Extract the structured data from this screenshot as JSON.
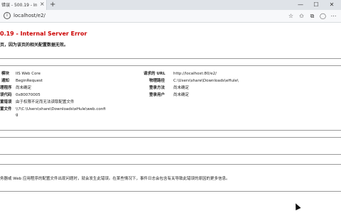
{
  "browser": {
    "tab_title": "错误 - 500.19 - Inte",
    "tab_close": "×",
    "new_tab": "+",
    "url": "localhost/e2/",
    "window_controls": [
      "—",
      "☐",
      "✕"
    ],
    "nav_icons": [
      "star-outline-icon",
      "favorites-icon",
      "collections-icon",
      "profile-icon",
      "more-icon"
    ]
  },
  "error": {
    "title": "0.19 - Internal Server Error",
    "subtitle": "页，因为该页的相关配置数据无效。"
  },
  "details_left": [
    {
      "label": "模块",
      "value": "IIS Web Core"
    },
    {
      "label": "通知",
      "value": "BeginRequest"
    },
    {
      "label": "理程序",
      "value": "尚未确定"
    },
    {
      "label": "误代码",
      "value": "0x80070005"
    },
    {
      "label": "置错误",
      "value": "由于权限不足而无法读取配置文件"
    },
    {
      "label": "置文件",
      "value": "\\\\?\\C:\\Users\\share\\Downloads\\eHule\\web.confi"
    }
  ],
  "details_left_wrap": "g",
  "details_right": [
    {
      "label": "请求的 URL",
      "value": "http://localhost:80/e2/"
    },
    {
      "label": "物理路径",
      "value": "C:\\Users\\share\\Downloads\\eHule\\"
    },
    {
      "label": "登录方法",
      "value": "尚未确定"
    },
    {
      "label": "登录用户",
      "value": "尚未确定"
    }
  ],
  "description": "务器或 Web 应用程序的配置文件出现问题时，就会发生此错误。在某些情况下，事件日志会包含有关导致此错误的原因的更多信息。"
}
